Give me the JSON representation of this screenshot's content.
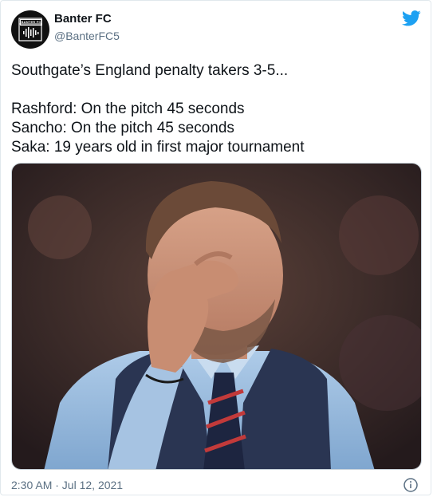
{
  "tweet": {
    "display_name": "Banter FC",
    "handle": "@BanterFC5",
    "avatar_label": "BANTER FC",
    "lines": [
      "Southgate’s England penalty takers 3-5...",
      "",
      "Rashford: On the pitch 45 seconds",
      "Sancho: On the pitch 45 seconds",
      "Saka: 19 years old in first major tournament"
    ],
    "image_description_icon": "photo-man-hand-on-face",
    "timestamp": "2:30 AM · Jul 12, 2021"
  },
  "icons": {
    "brand": "twitter-bird-icon",
    "info": "info-icon"
  },
  "colors": {
    "twitter_blue": "#1da1f2",
    "text_primary": "#0f1419",
    "text_secondary": "#5b7083"
  }
}
